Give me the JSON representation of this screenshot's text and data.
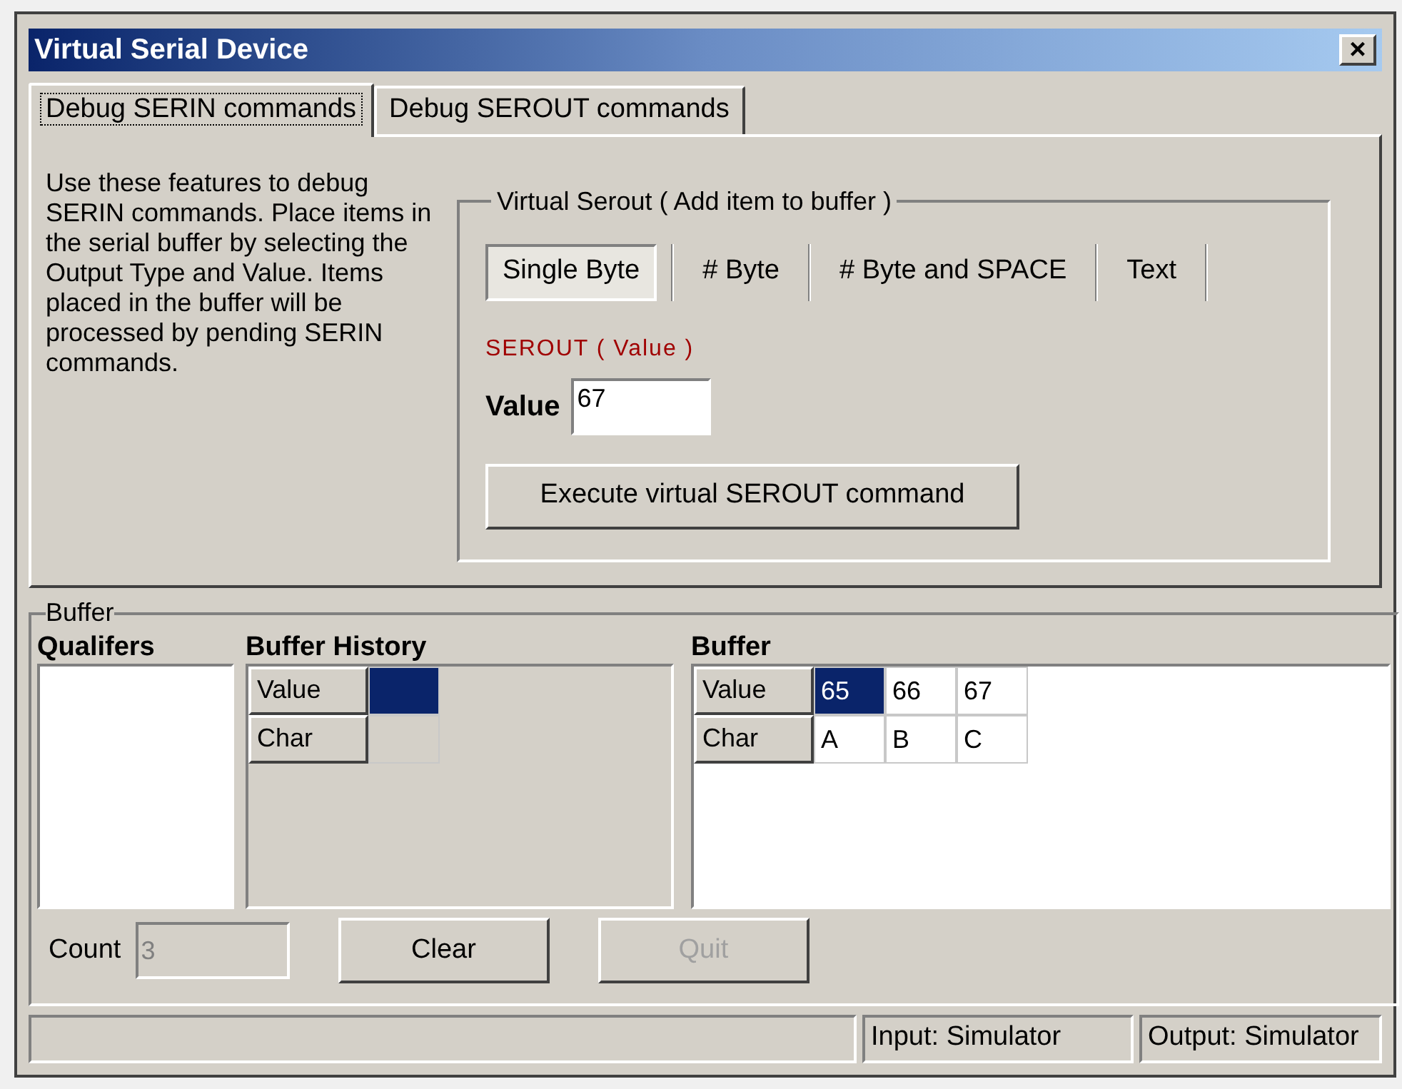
{
  "window": {
    "title": "Virtual Serial Device",
    "close_label": "×"
  },
  "tabs": [
    {
      "label": "Debug SERIN commands",
      "selected": true
    },
    {
      "label": "Debug SEROUT commands",
      "selected": false
    }
  ],
  "description": "Use these features to debug SERIN commands. Place items in the serial buffer by selecting the Output Type and Value. Items placed in the buffer will be processed by pending SERIN commands.",
  "virtual_serout": {
    "legend": "Virtual Serout  ( Add item to buffer )",
    "modes": [
      {
        "label": "Single Byte",
        "selected": true
      },
      {
        "label": "# Byte",
        "selected": false
      },
      {
        "label": "# Byte and SPACE",
        "selected": false
      },
      {
        "label": "Text",
        "selected": false
      }
    ],
    "format_label": "SEROUT ( Value )",
    "value_label": "Value",
    "value": "67",
    "execute_button": "Execute virtual SEROUT command"
  },
  "buffer_group": {
    "legend": "Buffer",
    "qualifiers": {
      "title": "Qualifers"
    },
    "history": {
      "title": "Buffer History",
      "row_headers": [
        "Value",
        "Char"
      ],
      "columns": [
        {
          "selected": true
        }
      ]
    },
    "buffer": {
      "title": "Buffer",
      "row_headers": [
        "Value",
        "Char"
      ],
      "columns": [
        {
          "value": "65",
          "char": "A",
          "selected": true
        },
        {
          "value": "66",
          "char": "B",
          "selected": false
        },
        {
          "value": "67",
          "char": "C",
          "selected": false
        }
      ]
    },
    "count_label": "Count",
    "count": "3",
    "count_disabled": true,
    "buttons": [
      {
        "label": "Clear",
        "disabled": false
      },
      {
        "label": "Quit",
        "disabled": true
      }
    ]
  },
  "status_bar": [
    "Input: Simulator",
    "Output: Simulator"
  ]
}
